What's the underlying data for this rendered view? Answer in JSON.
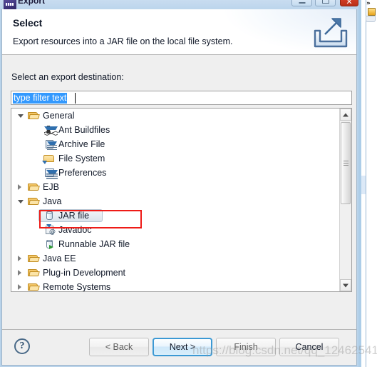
{
  "window": {
    "title": "Export",
    "icon": "eclipse-icon",
    "controls": {
      "minimize": "minimize-button",
      "maximize": "maximize-button",
      "close_glyph": "✕"
    }
  },
  "header": {
    "title": "Select",
    "description": "Export resources into a JAR file on the local file system.",
    "icon": "export-wizard-icon"
  },
  "content": {
    "destination_label": "Select an export destination:",
    "filter": {
      "value": "type filter text",
      "placeholder": "type filter text",
      "selected": true
    },
    "tree": [
      {
        "label": "General",
        "level": 1,
        "state": "expanded",
        "icon": "folder-open-icon"
      },
      {
        "label": "Ant Buildfiles",
        "level": 2,
        "state": "leaf",
        "icon": "ant-icon"
      },
      {
        "label": "Archive File",
        "level": 2,
        "state": "leaf",
        "icon": "archive-file-icon"
      },
      {
        "label": "File System",
        "level": 2,
        "state": "leaf",
        "icon": "folder-icon"
      },
      {
        "label": "Preferences",
        "level": 2,
        "state": "leaf",
        "icon": "preferences-icon"
      },
      {
        "label": "EJB",
        "level": 1,
        "state": "collapsed",
        "icon": "folder-open-icon"
      },
      {
        "label": "Java",
        "level": 1,
        "state": "expanded",
        "icon": "folder-open-icon"
      },
      {
        "label": "JAR file",
        "level": 2,
        "state": "leaf",
        "icon": "jar-file-icon",
        "selected": true,
        "annotated": true
      },
      {
        "label": "Javadoc",
        "level": 2,
        "state": "leaf",
        "icon": "javadoc-icon"
      },
      {
        "label": "Runnable JAR file",
        "level": 2,
        "state": "leaf",
        "icon": "runnable-jar-icon"
      },
      {
        "label": "Java EE",
        "level": 1,
        "state": "collapsed",
        "icon": "folder-open-icon"
      },
      {
        "label": "Plug-in Development",
        "level": 1,
        "state": "collapsed",
        "icon": "folder-open-icon"
      },
      {
        "label": "Remote Systems",
        "level": 1,
        "state": "collapsed",
        "icon": "folder-open-icon"
      }
    ]
  },
  "buttons": {
    "help": "?",
    "back": "< Back",
    "next": "Next >",
    "finish": "Finish",
    "cancel": "Cancel"
  },
  "watermark": "https://blog.csdn.net/qq_12462541",
  "colors": {
    "title_bar": "#c8dcf0",
    "close_button": "#cf3b23",
    "selection_blue": "#3399fe",
    "annotation_red": "#ee1b17",
    "default_button_border": "#3c99d4",
    "dialog_background": "#efefef"
  }
}
